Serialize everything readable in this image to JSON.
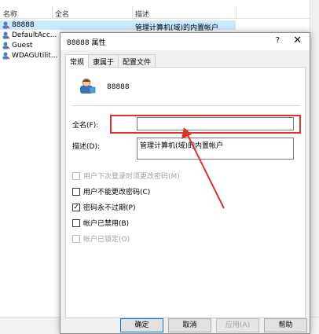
{
  "list": {
    "columns": [
      "名称",
      "全名",
      "描述"
    ],
    "users": [
      {
        "name": "88888",
        "selected": true
      },
      {
        "name": "DefaultAcc..."
      },
      {
        "name": "Guest"
      },
      {
        "name": "WDAGUtilit..."
      }
    ],
    "description": "管理计算机(域)的内置帐户"
  },
  "dialog": {
    "title": "88888 属性",
    "help": "?",
    "close": "✕",
    "tabs": [
      "常规",
      "隶属于",
      "配置文件"
    ],
    "username": "88888",
    "fullname_label": "全名(F):",
    "fullname_value": "",
    "description_label": "描述(D):",
    "description_value": "管理计算机(域)的内置帐户",
    "checkboxes": [
      {
        "label": "用户下次登录时须更改密码(M)",
        "checked": false,
        "disabled": true
      },
      {
        "label": "用户不能更改密码(C)",
        "checked": false,
        "disabled": false
      },
      {
        "label": "密码永不过期(P)",
        "checked": true,
        "disabled": false
      },
      {
        "label": "帐户已禁用(B)",
        "checked": false,
        "disabled": false
      },
      {
        "label": "帐户已锁定(O)",
        "checked": false,
        "disabled": true
      }
    ],
    "buttons": {
      "ok": "确定",
      "cancel": "取消",
      "apply": "应用(A)",
      "help": "帮助"
    }
  },
  "colors": {
    "annotation": "#e0302a",
    "selection": "#cce8ff",
    "accent": "#0078d7"
  }
}
